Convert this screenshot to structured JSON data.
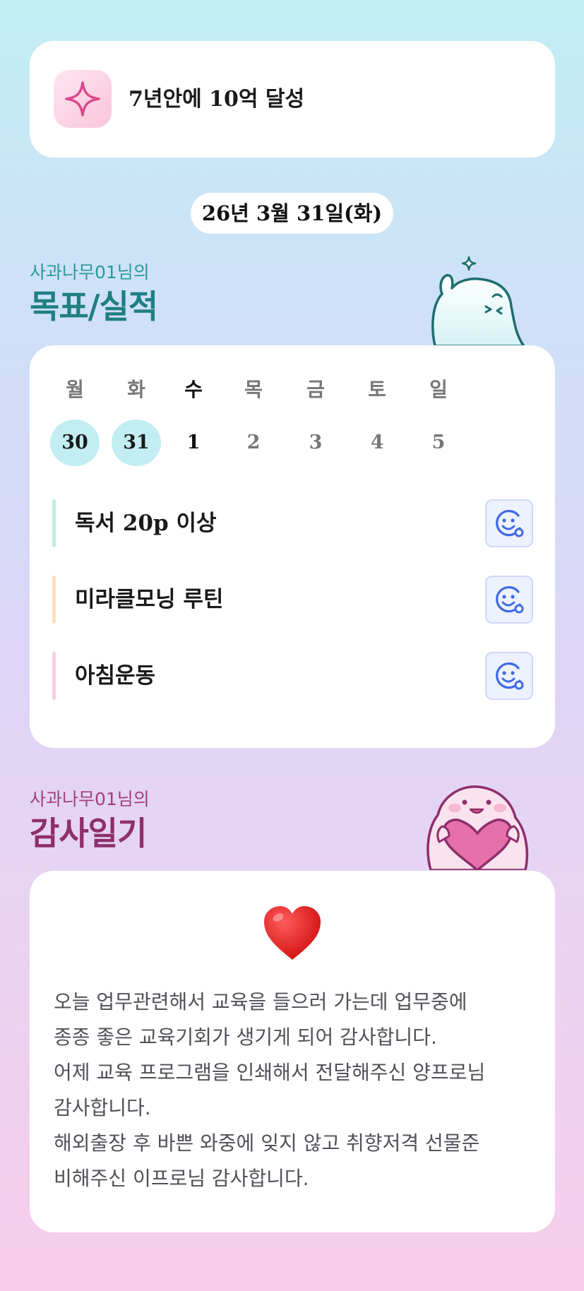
{
  "goal": {
    "title": "7년안에 10억 달성",
    "icon": "sparkle-icon"
  },
  "date": "26년 3월 31일(화)",
  "goal_section": {
    "subtitle": "사과나무01님의",
    "title": "목표/실적"
  },
  "week": {
    "days": [
      "월",
      "화",
      "수",
      "목",
      "금",
      "토",
      "일"
    ],
    "dates": [
      "30",
      "31",
      "1",
      "2",
      "3",
      "4",
      "5"
    ],
    "today_index": 2,
    "past_indices": [
      0,
      1
    ]
  },
  "tasks": [
    {
      "label": "독서 20p 이상",
      "bar_color": "#bfeedd",
      "icon": "smile-add-icon"
    },
    {
      "label": "미라클모닝 루틴",
      "bar_color": "#fde0bd",
      "icon": "smile-add-icon"
    },
    {
      "label": "아침운동",
      "bar_color": "#fbcde6",
      "icon": "smile-add-icon"
    }
  ],
  "gratitude_section": {
    "subtitle": "사과나무01님의",
    "title": "감사일기"
  },
  "gratitude": {
    "emoji": "❤️",
    "lines": [
      "오늘 업무관련해서 교육을 들으러 가는데 업무중에",
      "종종 좋은 교육기회가 생기게 되어 감사합니다.",
      "어제 교육 프로그램을 인쇄해서 전달해주신 양프로님",
      "감사합니다.",
      "해외출장 후 바쁜 와중에 잊지 않고 취향저격 선물준",
      "비해주신 이프로님 감사합니다."
    ]
  },
  "colors": {
    "teal_title": "#1f7f82",
    "plum_title": "#8e2f6c",
    "past_day_circle": "#c2eef3"
  }
}
